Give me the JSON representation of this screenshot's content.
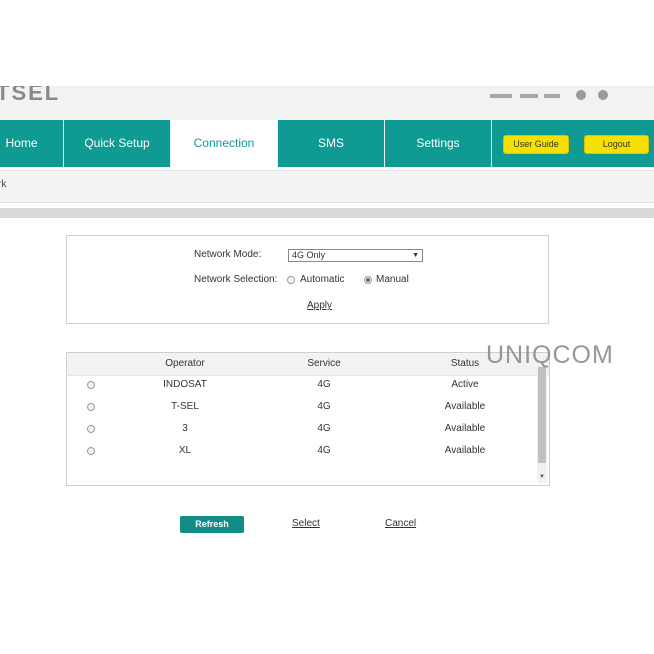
{
  "header": {
    "brand": "TSEL",
    "status_icons": [
      "signal-icon",
      "battery-icon",
      "wifi-icon",
      "info-icon"
    ]
  },
  "nav": {
    "items": [
      {
        "label": "Home"
      },
      {
        "label": "Quick Setup"
      },
      {
        "label": "Connection",
        "active": true
      },
      {
        "label": "SMS"
      },
      {
        "label": "Settings"
      }
    ],
    "user_guide": "User Guide",
    "logout": "Logout"
  },
  "subnav": {
    "label": "rk"
  },
  "network": {
    "mode_label": "Network Mode:",
    "mode_value": "4G Only",
    "selection_label": "Network Selection:",
    "options": [
      "Automatic",
      "Manual"
    ],
    "selected": "Manual",
    "apply": "Apply"
  },
  "operators": {
    "columns": [
      "Operator",
      "Service",
      "Status"
    ],
    "rows": [
      {
        "operator": "INDOSAT",
        "service": "4G",
        "status": "Active"
      },
      {
        "operator": "T-SEL",
        "service": "4G",
        "status": "Available"
      },
      {
        "operator": "3",
        "service": "4G",
        "status": "Available"
      },
      {
        "operator": "XL",
        "service": "4G",
        "status": "Available"
      }
    ]
  },
  "actions": {
    "refresh": "Refresh",
    "select": "Select",
    "cancel": "Cancel"
  },
  "watermark": "UNIQCOM",
  "colors": {
    "teal": "#0f9a94",
    "button_teal": "#118c86",
    "yellow": "#f5e000"
  }
}
